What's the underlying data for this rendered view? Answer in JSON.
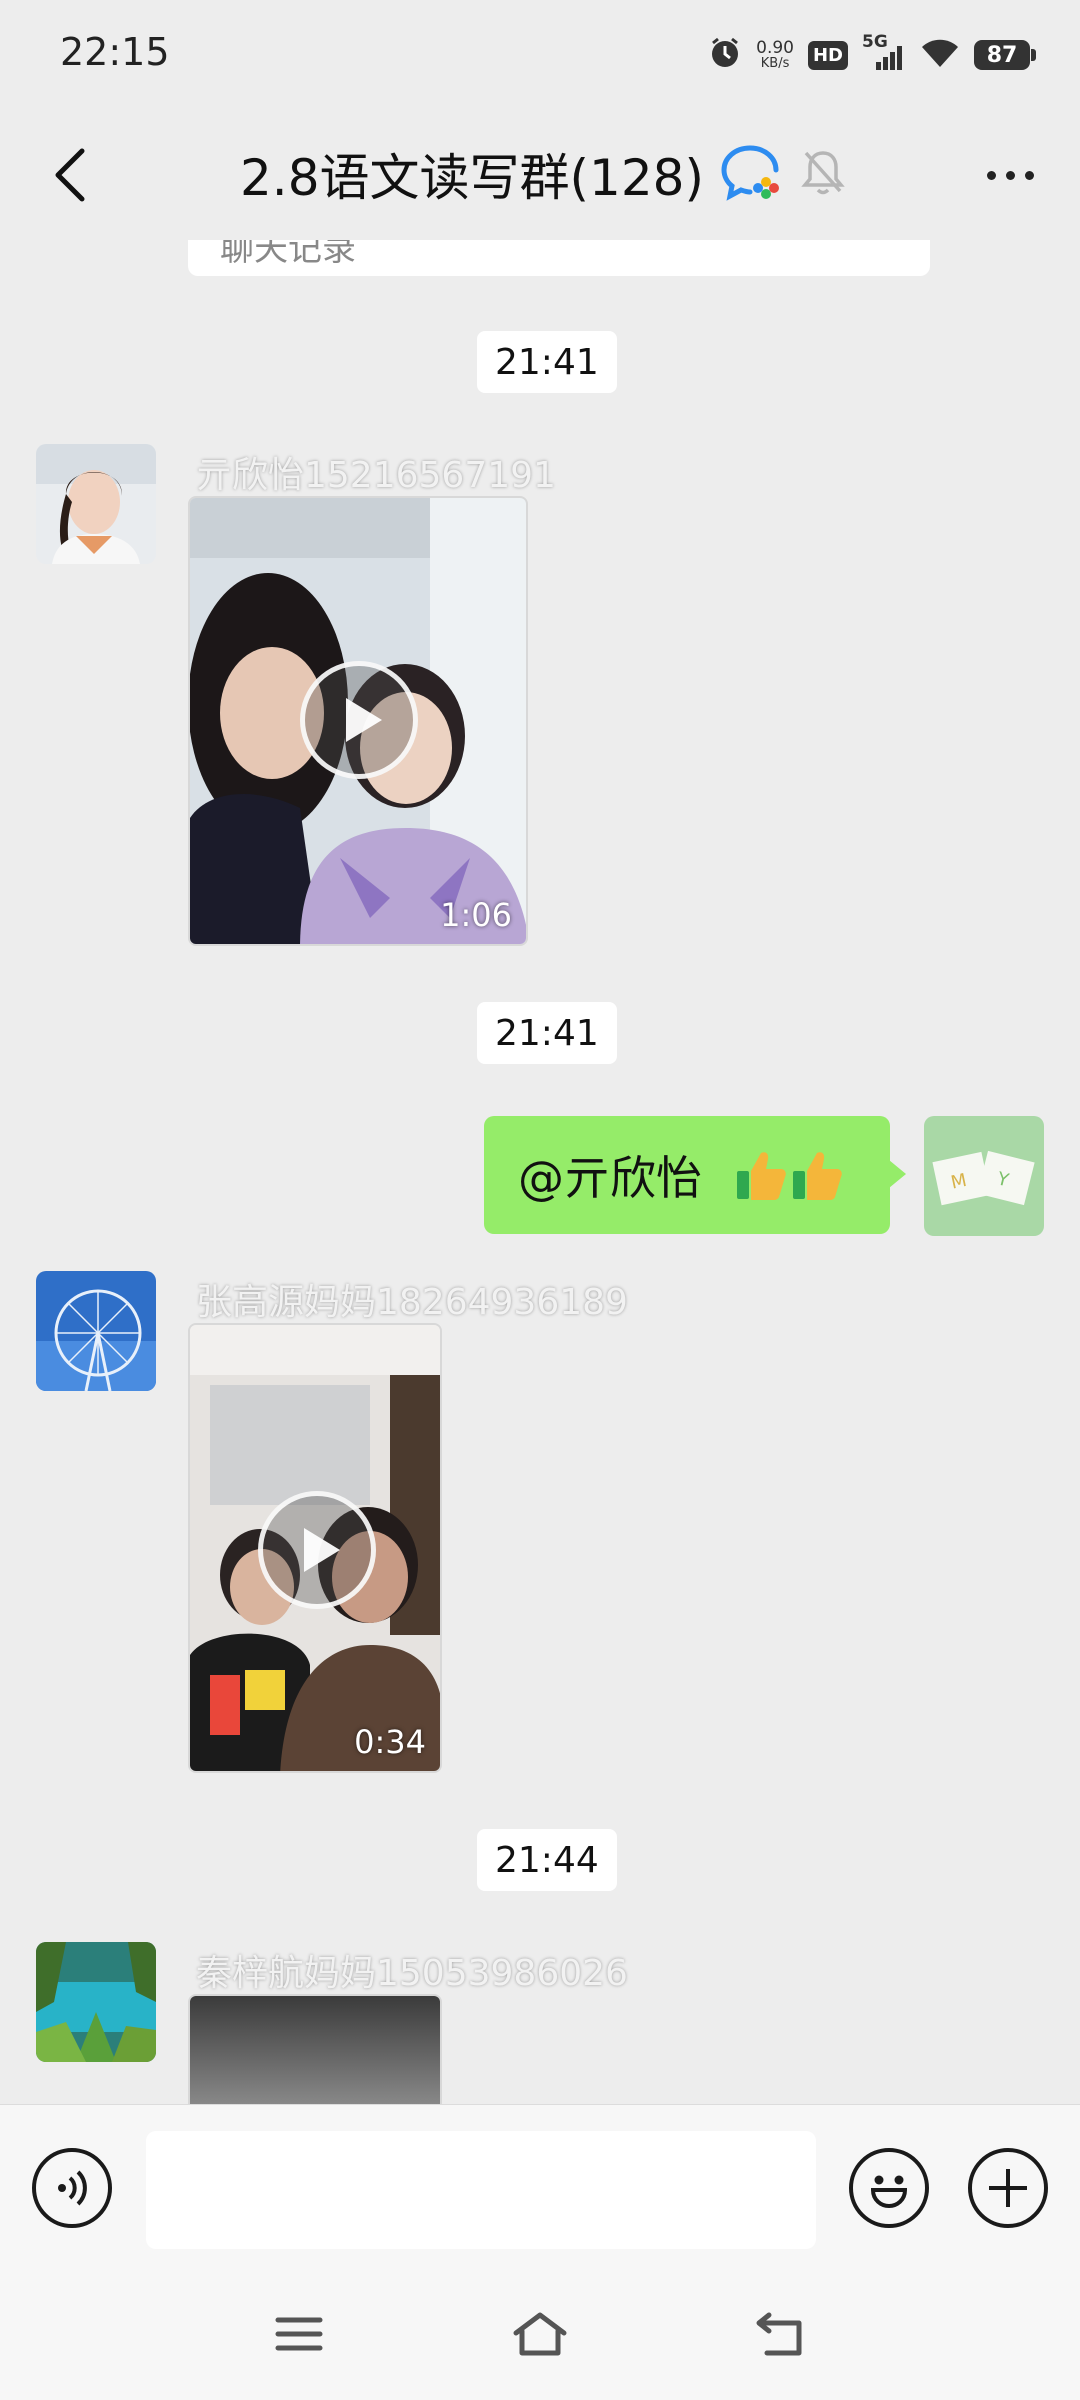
{
  "status_bar": {
    "time": "22:15",
    "net_speed_value": "0.90",
    "net_speed_unit": "KB/s",
    "hd_label": "HD",
    "network_label": "5G",
    "battery": "87"
  },
  "header": {
    "title": "2.8语文读写群(128)"
  },
  "chat": {
    "chatlog_card_text": "聊天记录",
    "messages": [
      {
        "time": "21:41",
        "sender": "亓欣怡15216567191",
        "video_duration": "1:06"
      },
      {
        "time": "21:41",
        "text": "@亓欣怡 "
      },
      {
        "sender": "张高源妈妈18264936189",
        "video_duration": "0:34"
      },
      {
        "time": "21:44",
        "sender": "秦梓航妈妈15053986026"
      }
    ]
  },
  "input_bar": {
    "placeholder": ""
  },
  "colors": {
    "background": "#ededed",
    "bubble_mine": "#95ec69",
    "wecom_blue": "#2d8cf0"
  },
  "icons": [
    "back-arrow-icon",
    "wecom-group-icon",
    "mute-bell-icon",
    "more-dots-icon",
    "voice-icon",
    "emoji-icon",
    "plus-icon",
    "menu-icon",
    "home-icon",
    "return-icon",
    "play-icon",
    "thumbs-up-icon"
  ]
}
